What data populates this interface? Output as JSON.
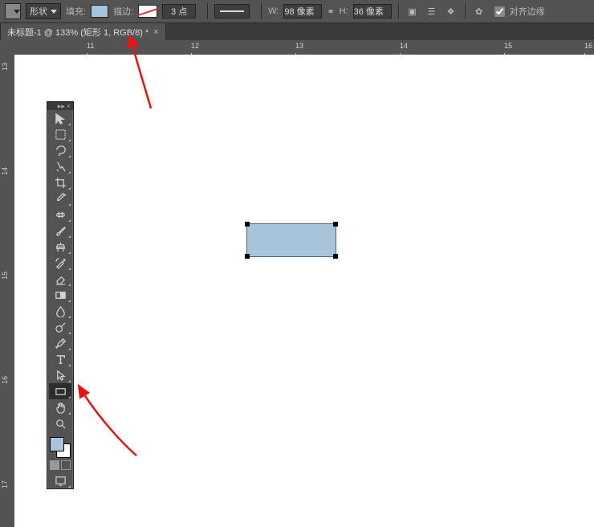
{
  "options_bar": {
    "shape_mode_label": "形状",
    "fill_label": "填充:",
    "stroke_label": "描边:",
    "stroke_width_value": "3 点",
    "width_prefix": "W:",
    "width_value": "98 像素",
    "height_prefix": "H:",
    "height_value": "36 像素",
    "align_edges_label": "对齐边缘",
    "align_edges_checked": true
  },
  "doc_tab": {
    "title": "未标题-1 @ 133% (矩形 1, RGB/8) *"
  },
  "ruler_marks_h": [
    "11",
    "12",
    "13",
    "14",
    "15",
    "16"
  ],
  "ruler_marks_v": [
    "13",
    "14",
    "15",
    "16",
    "17"
  ],
  "shape": {
    "fill_color": "#a8c4da"
  },
  "tools": [
    {
      "name": "move",
      "icon": "move"
    },
    {
      "name": "marquee",
      "icon": "marquee"
    },
    {
      "name": "lasso",
      "icon": "lasso"
    },
    {
      "name": "wand",
      "icon": "wand"
    },
    {
      "name": "crop",
      "icon": "crop"
    },
    {
      "name": "eyedrop",
      "icon": "eyedrop"
    },
    {
      "name": "heal",
      "icon": "heal"
    },
    {
      "name": "brush",
      "icon": "brush"
    },
    {
      "name": "stamp",
      "icon": "stamp"
    },
    {
      "name": "history-brush",
      "icon": "history"
    },
    {
      "name": "eraser",
      "icon": "eraser"
    },
    {
      "name": "gradient",
      "icon": "gradient"
    },
    {
      "name": "blur",
      "icon": "blur"
    },
    {
      "name": "dodge",
      "icon": "dodge"
    },
    {
      "name": "pen",
      "icon": "pen"
    },
    {
      "name": "type",
      "icon": "type"
    },
    {
      "name": "path-select",
      "icon": "path"
    },
    {
      "name": "rectangle",
      "icon": "rect",
      "active": true
    },
    {
      "name": "hand",
      "icon": "hand"
    },
    {
      "name": "zoom",
      "icon": "zoom"
    }
  ]
}
